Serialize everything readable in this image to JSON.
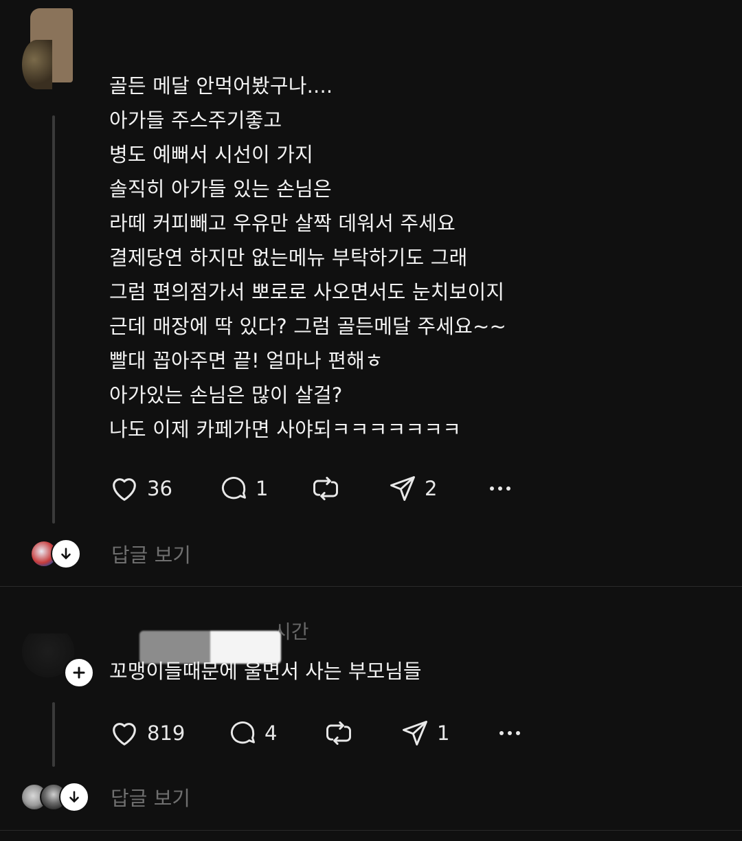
{
  "posts": [
    {
      "lines": [
        "골든 메달 안먹어봤구나....",
        "아가들 주스주기좋고",
        "병도 예뻐서 시선이 가지",
        "솔직히 아가들 있는 손님은",
        "라떼 커피빼고 우유만 살짝 데워서 주세요",
        "결제당연 하지만 없는메뉴 부탁하기도 그래",
        "그럼 편의점가서 뽀로로 사오면서도 눈치보이지",
        "근데 매장에 딱 있다? 그럼 골든메달 주세요~~",
        "빨대 꼽아주면 끝! 얼마나 편해ㅎ",
        "아가있는 손님은 많이 살걸?",
        "나도 이제 카페가면 사야되ㅋㅋㅋㅋㅋㅋㅋ"
      ],
      "likes": "36",
      "replies": "1",
      "shares": "2",
      "view_replies_label": "답글 보기"
    },
    {
      "timestamp": "시간",
      "lines": [
        "꼬맹이들때문에 울면서 사는 부모님들"
      ],
      "likes": "819",
      "replies": "4",
      "shares": "1",
      "view_replies_label": "답글 보기"
    }
  ],
  "icons": {
    "like": "heart-icon",
    "reply": "speech-bubble-icon",
    "repost": "repost-icon",
    "share": "paper-plane-icon",
    "more": "more-dots-icon",
    "expand": "arrow-down-icon",
    "follow": "plus-icon"
  },
  "colors": {
    "background": "#101010",
    "text": "#f3f3f3",
    "muted": "#6f6f6f"
  }
}
